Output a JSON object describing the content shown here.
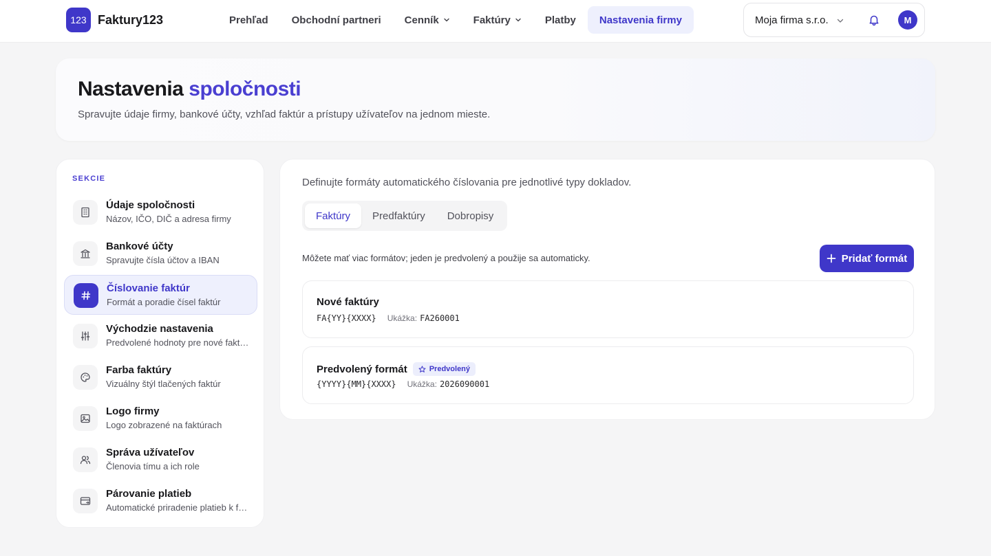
{
  "brand": {
    "logo_text": "123",
    "name": "Faktury123"
  },
  "nav": {
    "items": [
      {
        "label": "Prehľad",
        "dropdown": false,
        "active": false
      },
      {
        "label": "Obchodní partneri",
        "dropdown": false,
        "active": false
      },
      {
        "label": "Cenník",
        "dropdown": true,
        "active": false
      },
      {
        "label": "Faktúry",
        "dropdown": true,
        "active": false
      },
      {
        "label": "Platby",
        "dropdown": false,
        "active": false
      },
      {
        "label": "Nastavenia firmy",
        "dropdown": false,
        "active": true
      }
    ]
  },
  "account": {
    "company": "Moja firma s.r.o.",
    "avatar_initial": "M",
    "bell_icon": "bell-icon"
  },
  "hero": {
    "title_main": "Nastavenia",
    "title_accent": "spoločnosti",
    "subtitle": "Spravujte údaje firmy, bankové účty, vzhľad faktúr a prístupy užívateľov na jednom mieste."
  },
  "sidebar": {
    "heading": "SEKCIE",
    "items": [
      {
        "title": "Údaje spoločnosti",
        "desc": "Názov, IČO, DIČ a adresa firmy",
        "icon": "building-icon",
        "active": false
      },
      {
        "title": "Bankové účty",
        "desc": "Spravujte čísla účtov a IBAN",
        "icon": "bank-icon",
        "active": false
      },
      {
        "title": "Číslovanie faktúr",
        "desc": "Formát a poradie čísel faktúr",
        "icon": "hash-icon",
        "active": true
      },
      {
        "title": "Východzie nastavenia",
        "desc": "Predvolené hodnoty pre nové faktúry",
        "icon": "sliders-icon",
        "active": false
      },
      {
        "title": "Farba faktúry",
        "desc": "Vizuálny štýl tlačených faktúr",
        "icon": "palette-icon",
        "active": false
      },
      {
        "title": "Logo firmy",
        "desc": "Logo zobrazené na faktúrach",
        "icon": "image-icon",
        "active": false
      },
      {
        "title": "Správa užívateľov",
        "desc": "Členovia tímu a ich role",
        "icon": "users-icon",
        "active": false
      },
      {
        "title": "Párovanie platieb",
        "desc": "Automatické priradenie platieb k faktúram",
        "icon": "payment-card-icon",
        "active": false
      }
    ]
  },
  "main": {
    "intro": "Definujte formáty automatického číslovania pre jednotlivé typy dokladov.",
    "tabs": [
      {
        "label": "Faktúry",
        "active": true
      },
      {
        "label": "Predfaktúry",
        "active": false
      },
      {
        "label": "Dobropisy",
        "active": false
      }
    ],
    "hint": "Môžete mať viac formátov; jeden je predvolený a použije sa automaticky.",
    "add_button": "Pridať formát",
    "example_label": "Ukážka:",
    "formats": [
      {
        "name": "Nové faktúry",
        "pattern": "FA{YY}{XXXX}",
        "example": "FA260001",
        "is_default": false,
        "badge": ""
      },
      {
        "name": "Predvolený formát",
        "pattern": "{YYYY}{MM}{XXXX}",
        "example": "2026090001",
        "is_default": true,
        "badge": "Predvolený"
      }
    ]
  },
  "colors": {
    "accent": "#3f37c9",
    "accent_soft": "#eef0fd",
    "text": "#18181b",
    "muted": "#52525b",
    "background": "#f5f5f6"
  }
}
